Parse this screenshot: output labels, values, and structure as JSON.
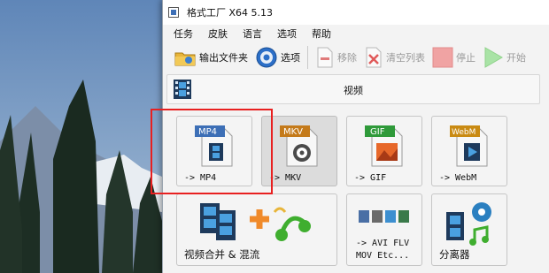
{
  "window": {
    "title": "格式工厂 X64 5.13"
  },
  "menu": [
    "任务",
    "皮肤",
    "语言",
    "选项",
    "帮助"
  ],
  "toolbar": {
    "output_folder": "输出文件夹",
    "options": "选项",
    "remove": "移除",
    "clear_list": "清空列表",
    "stop": "停止",
    "start": "开始"
  },
  "category": {
    "label": "视频"
  },
  "tiles": [
    {
      "badge": "MP4",
      "label": "-> MP4",
      "badge_color": "#3d6fb6"
    },
    {
      "badge": "MKV",
      "label": "-> MKV",
      "badge_color": "#c47a1a"
    },
    {
      "badge": "GIF",
      "label": "-> GIF",
      "badge_color": "#2f9a3a"
    },
    {
      "badge": "WebM",
      "label": "-> WebM",
      "badge_color": "#c98a12"
    },
    {
      "label": "视频合并 & 混流"
    },
    {
      "label_line1": "-> AVI FLV",
      "label_line2": "MOV Etc..."
    },
    {
      "label": "分离器"
    }
  ],
  "selected_tile": "-> MP4",
  "colors": {
    "highlight": "#e82020",
    "toolbar_disabled_text": "#9a9a9a"
  }
}
